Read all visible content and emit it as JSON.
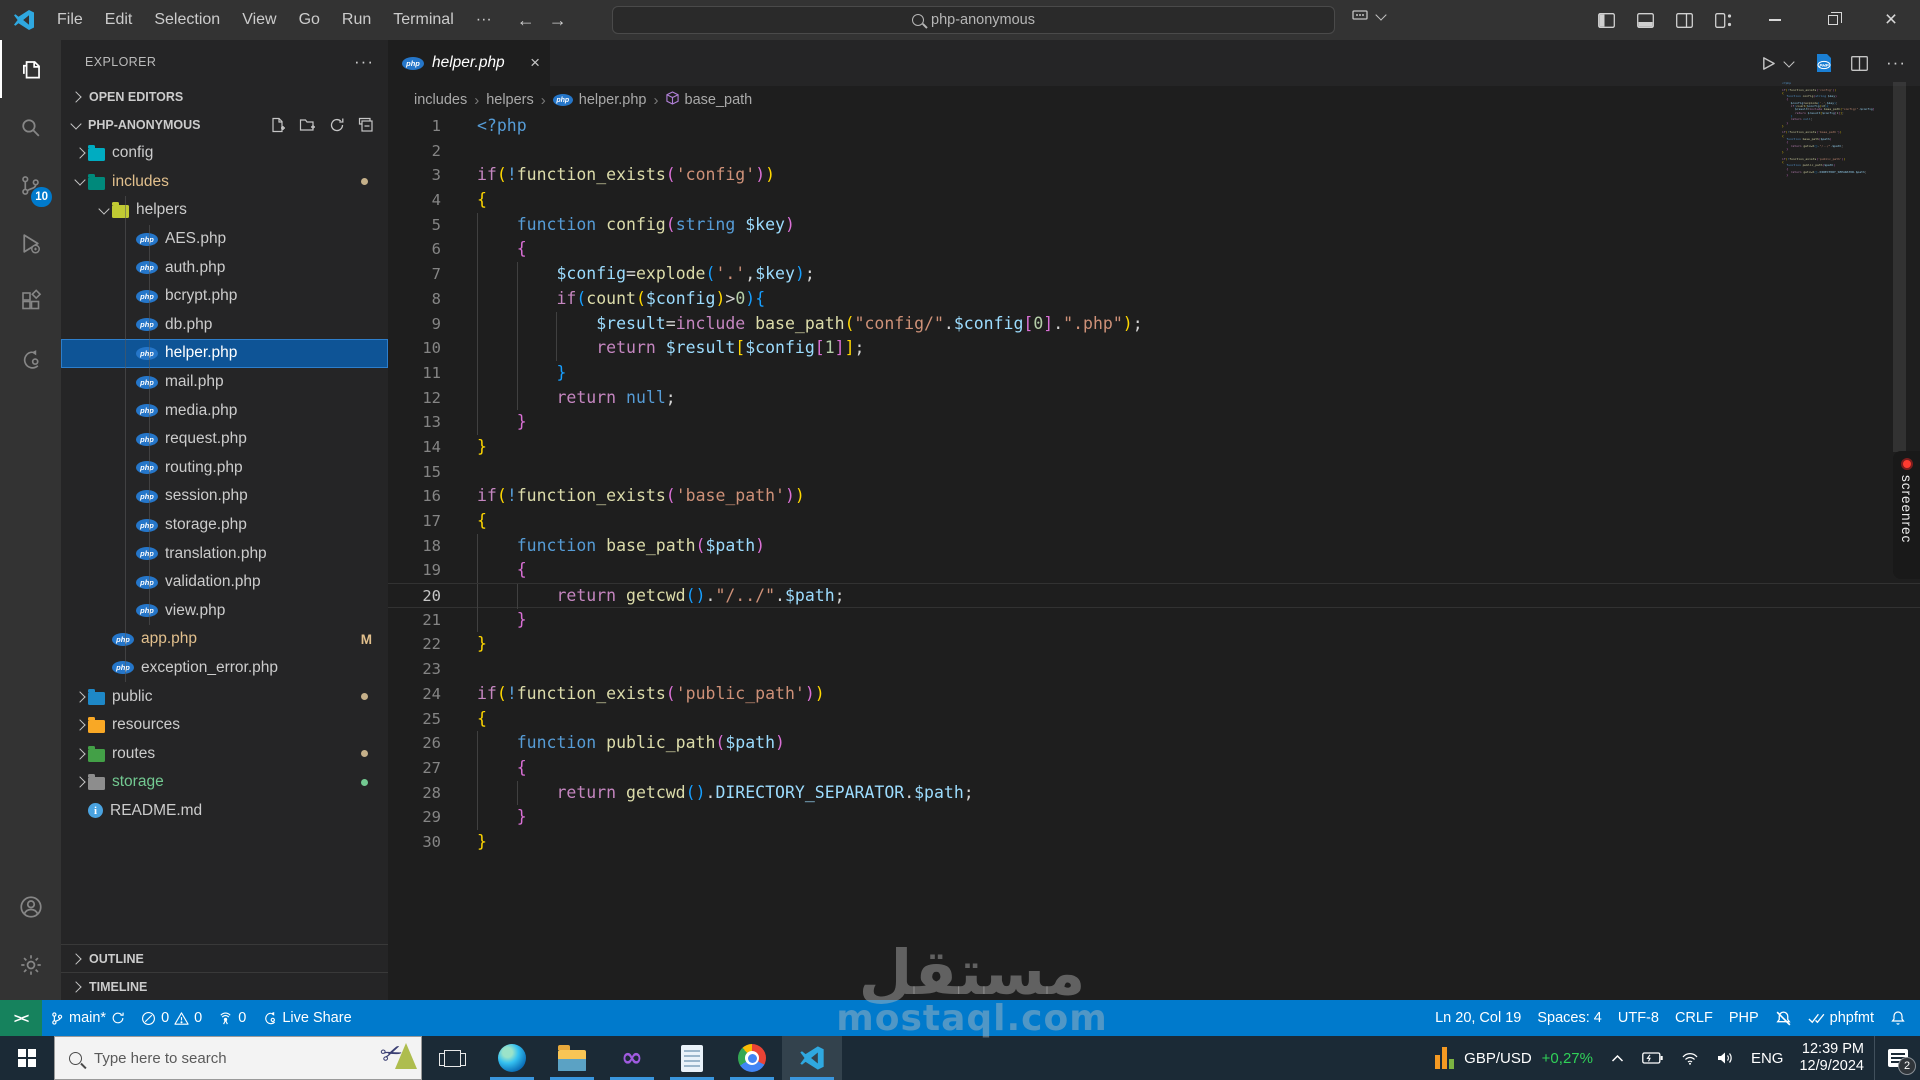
{
  "titlebar": {
    "menus": [
      "File",
      "Edit",
      "Selection",
      "View",
      "Go",
      "Run",
      "Terminal",
      "···"
    ],
    "back_arrow": "←",
    "forward_arrow": "→",
    "search_value": "php-anonymous",
    "close_glyph": "×"
  },
  "activity_bar": {
    "source_control_badge": "10"
  },
  "explorer": {
    "title": "EXPLORER",
    "more_glyph": "···",
    "open_editors": "OPEN EDITORS",
    "root": "PHP-ANONYMOUS",
    "outline": "OUTLINE",
    "timeline": "TIMELINE",
    "tree": [
      {
        "label": "config",
        "level": 0,
        "chevron": "right",
        "icon": "folder",
        "color": "#00acc1"
      },
      {
        "label": "includes",
        "level": 0,
        "chevron": "down",
        "icon": "folder",
        "color": "#00897b",
        "text": "#E2C08D",
        "dot": "#c5b089"
      },
      {
        "label": "helpers",
        "level": 1,
        "chevron": "down",
        "icon": "folder",
        "color": "#c0ca33"
      },
      {
        "label": "AES.php",
        "level": 2,
        "icon": "php"
      },
      {
        "label": "auth.php",
        "level": 2,
        "icon": "php"
      },
      {
        "label": "bcrypt.php",
        "level": 2,
        "icon": "php"
      },
      {
        "label": "db.php",
        "level": 2,
        "icon": "php"
      },
      {
        "label": "helper.php",
        "level": 2,
        "icon": "php",
        "selected": true
      },
      {
        "label": "mail.php",
        "level": 2,
        "icon": "php"
      },
      {
        "label": "media.php",
        "level": 2,
        "icon": "php"
      },
      {
        "label": "request.php",
        "level": 2,
        "icon": "php"
      },
      {
        "label": "routing.php",
        "level": 2,
        "icon": "php"
      },
      {
        "label": "session.php",
        "level": 2,
        "icon": "php"
      },
      {
        "label": "storage.php",
        "level": 2,
        "icon": "php"
      },
      {
        "label": "translation.php",
        "level": 2,
        "icon": "php"
      },
      {
        "label": "validation.php",
        "level": 2,
        "icon": "php"
      },
      {
        "label": "view.php",
        "level": 2,
        "icon": "php"
      },
      {
        "label": "app.php",
        "level": 1,
        "icon": "php",
        "text": "#E2C08D",
        "badge": "M",
        "badgeColor": "#E2C08D"
      },
      {
        "label": "exception_error.php",
        "level": 1,
        "icon": "php"
      },
      {
        "label": "public",
        "level": 0,
        "chevron": "right",
        "icon": "folder",
        "color": "#1e88c7",
        "dot": "#c5b089"
      },
      {
        "label": "resources",
        "level": 0,
        "chevron": "right",
        "icon": "folder",
        "color": "#f9a825"
      },
      {
        "label": "routes",
        "level": 0,
        "chevron": "right",
        "icon": "folder",
        "color": "#43a047",
        "dot": "#c5b089"
      },
      {
        "label": "storage",
        "level": 0,
        "chevron": "right",
        "icon": "folder",
        "color": "#8d8d8d",
        "text": "#73C991",
        "dot": "#73C991"
      },
      {
        "label": "README.md",
        "level": 0,
        "icon": "info"
      }
    ]
  },
  "editor": {
    "tab": {
      "label": "helper.php",
      "close": "×"
    },
    "breadcrumbs": [
      "includes",
      "helpers",
      "helper.php",
      "base_path"
    ],
    "code": {
      "lines": [
        {
          "n": 1,
          "ind": 0,
          "s": [
            [
              "<?php",
              "php"
            ]
          ]
        },
        {
          "n": 2,
          "ind": 0,
          "s": []
        },
        {
          "n": 3,
          "ind": 0,
          "s": [
            [
              "if",
              "kw"
            ],
            [
              "(",
              "b1"
            ],
            [
              "!",
              "php"
            ],
            [
              "function_exists",
              "fn"
            ],
            [
              "(",
              "b2"
            ],
            [
              "'config'",
              "str"
            ],
            [
              ")",
              "b2"
            ],
            [
              ")",
              "b1"
            ]
          ]
        },
        {
          "n": 4,
          "ind": 0,
          "s": [
            [
              "{",
              "b1"
            ]
          ]
        },
        {
          "n": 5,
          "ind": 4,
          "s": [
            [
              "function ",
              "php"
            ],
            [
              "config",
              "fn"
            ],
            [
              "(",
              "b2"
            ],
            [
              "string ",
              "php"
            ],
            [
              "$key",
              "var"
            ],
            [
              ")",
              "b2"
            ]
          ]
        },
        {
          "n": 6,
          "ind": 4,
          "s": [
            [
              "{",
              "b2"
            ]
          ]
        },
        {
          "n": 7,
          "ind": 8,
          "s": [
            [
              "$config",
              "var"
            ],
            [
              "=",
              "pun"
            ],
            [
              "explode",
              "fn"
            ],
            [
              "(",
              "b3"
            ],
            [
              "'.'",
              "str"
            ],
            [
              ",",
              "pun"
            ],
            [
              "$key",
              "var"
            ],
            [
              ")",
              "b3"
            ],
            [
              ";",
              "pun"
            ]
          ]
        },
        {
          "n": 8,
          "ind": 8,
          "s": [
            [
              "if",
              "kw"
            ],
            [
              "(",
              "b3"
            ],
            [
              "count",
              "fn"
            ],
            [
              "(",
              "b1"
            ],
            [
              "$config",
              "var"
            ],
            [
              ")",
              "b1"
            ],
            [
              ">",
              "pun"
            ],
            [
              "0",
              "num"
            ],
            [
              ")",
              "b3"
            ],
            [
              "{",
              "b3"
            ]
          ]
        },
        {
          "n": 9,
          "ind": 12,
          "s": [
            [
              "$result",
              "var"
            ],
            [
              "=",
              "pun"
            ],
            [
              "include",
              "kw"
            ],
            [
              " ",
              "pun"
            ],
            [
              "base_path",
              "fn"
            ],
            [
              "(",
              "b1"
            ],
            [
              "\"config/\"",
              "str"
            ],
            [
              ".",
              "pun"
            ],
            [
              "$config",
              "var"
            ],
            [
              "[",
              "b2"
            ],
            [
              "0",
              "num"
            ],
            [
              "]",
              "b2"
            ],
            [
              ".",
              "pun"
            ],
            [
              "\".php\"",
              "str"
            ],
            [
              ")",
              "b1"
            ],
            [
              ";",
              "pun"
            ]
          ]
        },
        {
          "n": 10,
          "ind": 12,
          "s": [
            [
              "return",
              "kw"
            ],
            [
              " ",
              "pun"
            ],
            [
              "$result",
              "var"
            ],
            [
              "[",
              "b1"
            ],
            [
              "$config",
              "var"
            ],
            [
              "[",
              "b2"
            ],
            [
              "1",
              "num"
            ],
            [
              "]",
              "b2"
            ],
            [
              "]",
              "b1"
            ],
            [
              ";",
              "pun"
            ]
          ]
        },
        {
          "n": 11,
          "ind": 8,
          "s": [
            [
              "}",
              "b3"
            ]
          ]
        },
        {
          "n": 12,
          "ind": 8,
          "s": [
            [
              "return",
              "kw"
            ],
            [
              " ",
              "pun"
            ],
            [
              "null",
              "php"
            ],
            [
              ";",
              "pun"
            ]
          ]
        },
        {
          "n": 13,
          "ind": 4,
          "s": [
            [
              "}",
              "b2"
            ]
          ]
        },
        {
          "n": 14,
          "ind": 0,
          "s": [
            [
              "}",
              "b1"
            ]
          ]
        },
        {
          "n": 15,
          "ind": 0,
          "s": []
        },
        {
          "n": 16,
          "ind": 0,
          "s": [
            [
              "if",
              "kw"
            ],
            [
              "(",
              "b1"
            ],
            [
              "!",
              "php"
            ],
            [
              "function_exists",
              "fn"
            ],
            [
              "(",
              "b2"
            ],
            [
              "'base_path'",
              "str"
            ],
            [
              ")",
              "b2"
            ],
            [
              ")",
              "b1"
            ]
          ]
        },
        {
          "n": 17,
          "ind": 0,
          "s": [
            [
              "{",
              "b1"
            ]
          ]
        },
        {
          "n": 18,
          "ind": 4,
          "s": [
            [
              "function ",
              "php"
            ],
            [
              "base_path",
              "fn"
            ],
            [
              "(",
              "b2"
            ],
            [
              "$path",
              "var"
            ],
            [
              ")",
              "b2"
            ]
          ]
        },
        {
          "n": 19,
          "ind": 4,
          "s": [
            [
              "{",
              "b2"
            ]
          ]
        },
        {
          "n": 20,
          "ind": 8,
          "current": true,
          "s": [
            [
              "return",
              "kw"
            ],
            [
              " ",
              "pun"
            ],
            [
              "getcwd",
              "fn"
            ],
            [
              "(",
              "b3"
            ],
            [
              ")",
              "b3"
            ],
            [
              ".",
              "pun"
            ],
            [
              "\"/../\"",
              "str"
            ],
            [
              ".",
              "pun"
            ],
            [
              "$path",
              "var"
            ],
            [
              ";",
              "pun"
            ]
          ]
        },
        {
          "n": 21,
          "ind": 4,
          "s": [
            [
              "}",
              "b2"
            ]
          ]
        },
        {
          "n": 22,
          "ind": 0,
          "s": [
            [
              "}",
              "b1"
            ]
          ]
        },
        {
          "n": 23,
          "ind": 0,
          "s": []
        },
        {
          "n": 24,
          "ind": 0,
          "s": [
            [
              "if",
              "kw"
            ],
            [
              "(",
              "b1"
            ],
            [
              "!",
              "php"
            ],
            [
              "function_exists",
              "fn"
            ],
            [
              "(",
              "b2"
            ],
            [
              "'public_path'",
              "str"
            ],
            [
              ")",
              "b2"
            ],
            [
              ")",
              "b1"
            ]
          ]
        },
        {
          "n": 25,
          "ind": 0,
          "s": [
            [
              "{",
              "b1"
            ]
          ]
        },
        {
          "n": 26,
          "ind": 4,
          "s": [
            [
              "function ",
              "php"
            ],
            [
              "public_path",
              "fn"
            ],
            [
              "(",
              "b2"
            ],
            [
              "$path",
              "var"
            ],
            [
              ")",
              "b2"
            ]
          ]
        },
        {
          "n": 27,
          "ind": 4,
          "s": [
            [
              "{",
              "b2"
            ]
          ]
        },
        {
          "n": 28,
          "ind": 8,
          "s": [
            [
              "return",
              "kw"
            ],
            [
              " ",
              "pun"
            ],
            [
              "getcwd",
              "fn"
            ],
            [
              "(",
              "b3"
            ],
            [
              ")",
              "b3"
            ],
            [
              ".",
              "pun"
            ],
            [
              "DIRECTORY_SEPARATOR",
              "var"
            ],
            [
              ".",
              "pun"
            ],
            [
              "$path",
              "var"
            ],
            [
              ";",
              "pun"
            ]
          ]
        },
        {
          "n": 29,
          "ind": 4,
          "s": [
            [
              "}",
              "b2"
            ]
          ]
        },
        {
          "n": 30,
          "ind": 0,
          "s": [
            [
              "}",
              "b1"
            ]
          ]
        }
      ]
    }
  },
  "status_bar": {
    "remote": "><",
    "branch": "main*",
    "errors": "0",
    "warnings": "0",
    "broadcast": "0",
    "live_share": "Live Share",
    "cursor": "Ln 20, Col 19",
    "spaces": "Spaces: 4",
    "encoding": "UTF-8",
    "eol": "CRLF",
    "language": "PHP",
    "formatter": "phpfmt",
    "accent": "#007ACC",
    "remote_bg": "#16825D"
  },
  "taskbar": {
    "search_placeholder": "Type here to search",
    "tray": {
      "pair": "GBP/USD",
      "change": "+0,27%",
      "lang": "ENG",
      "time": "12:39 PM",
      "date": "12/9/2024",
      "badge": "2"
    }
  },
  "watermark": {
    "arabic": "مستقل",
    "latin": "mostaql.com"
  },
  "screenrec": {
    "label": "screenrec"
  }
}
